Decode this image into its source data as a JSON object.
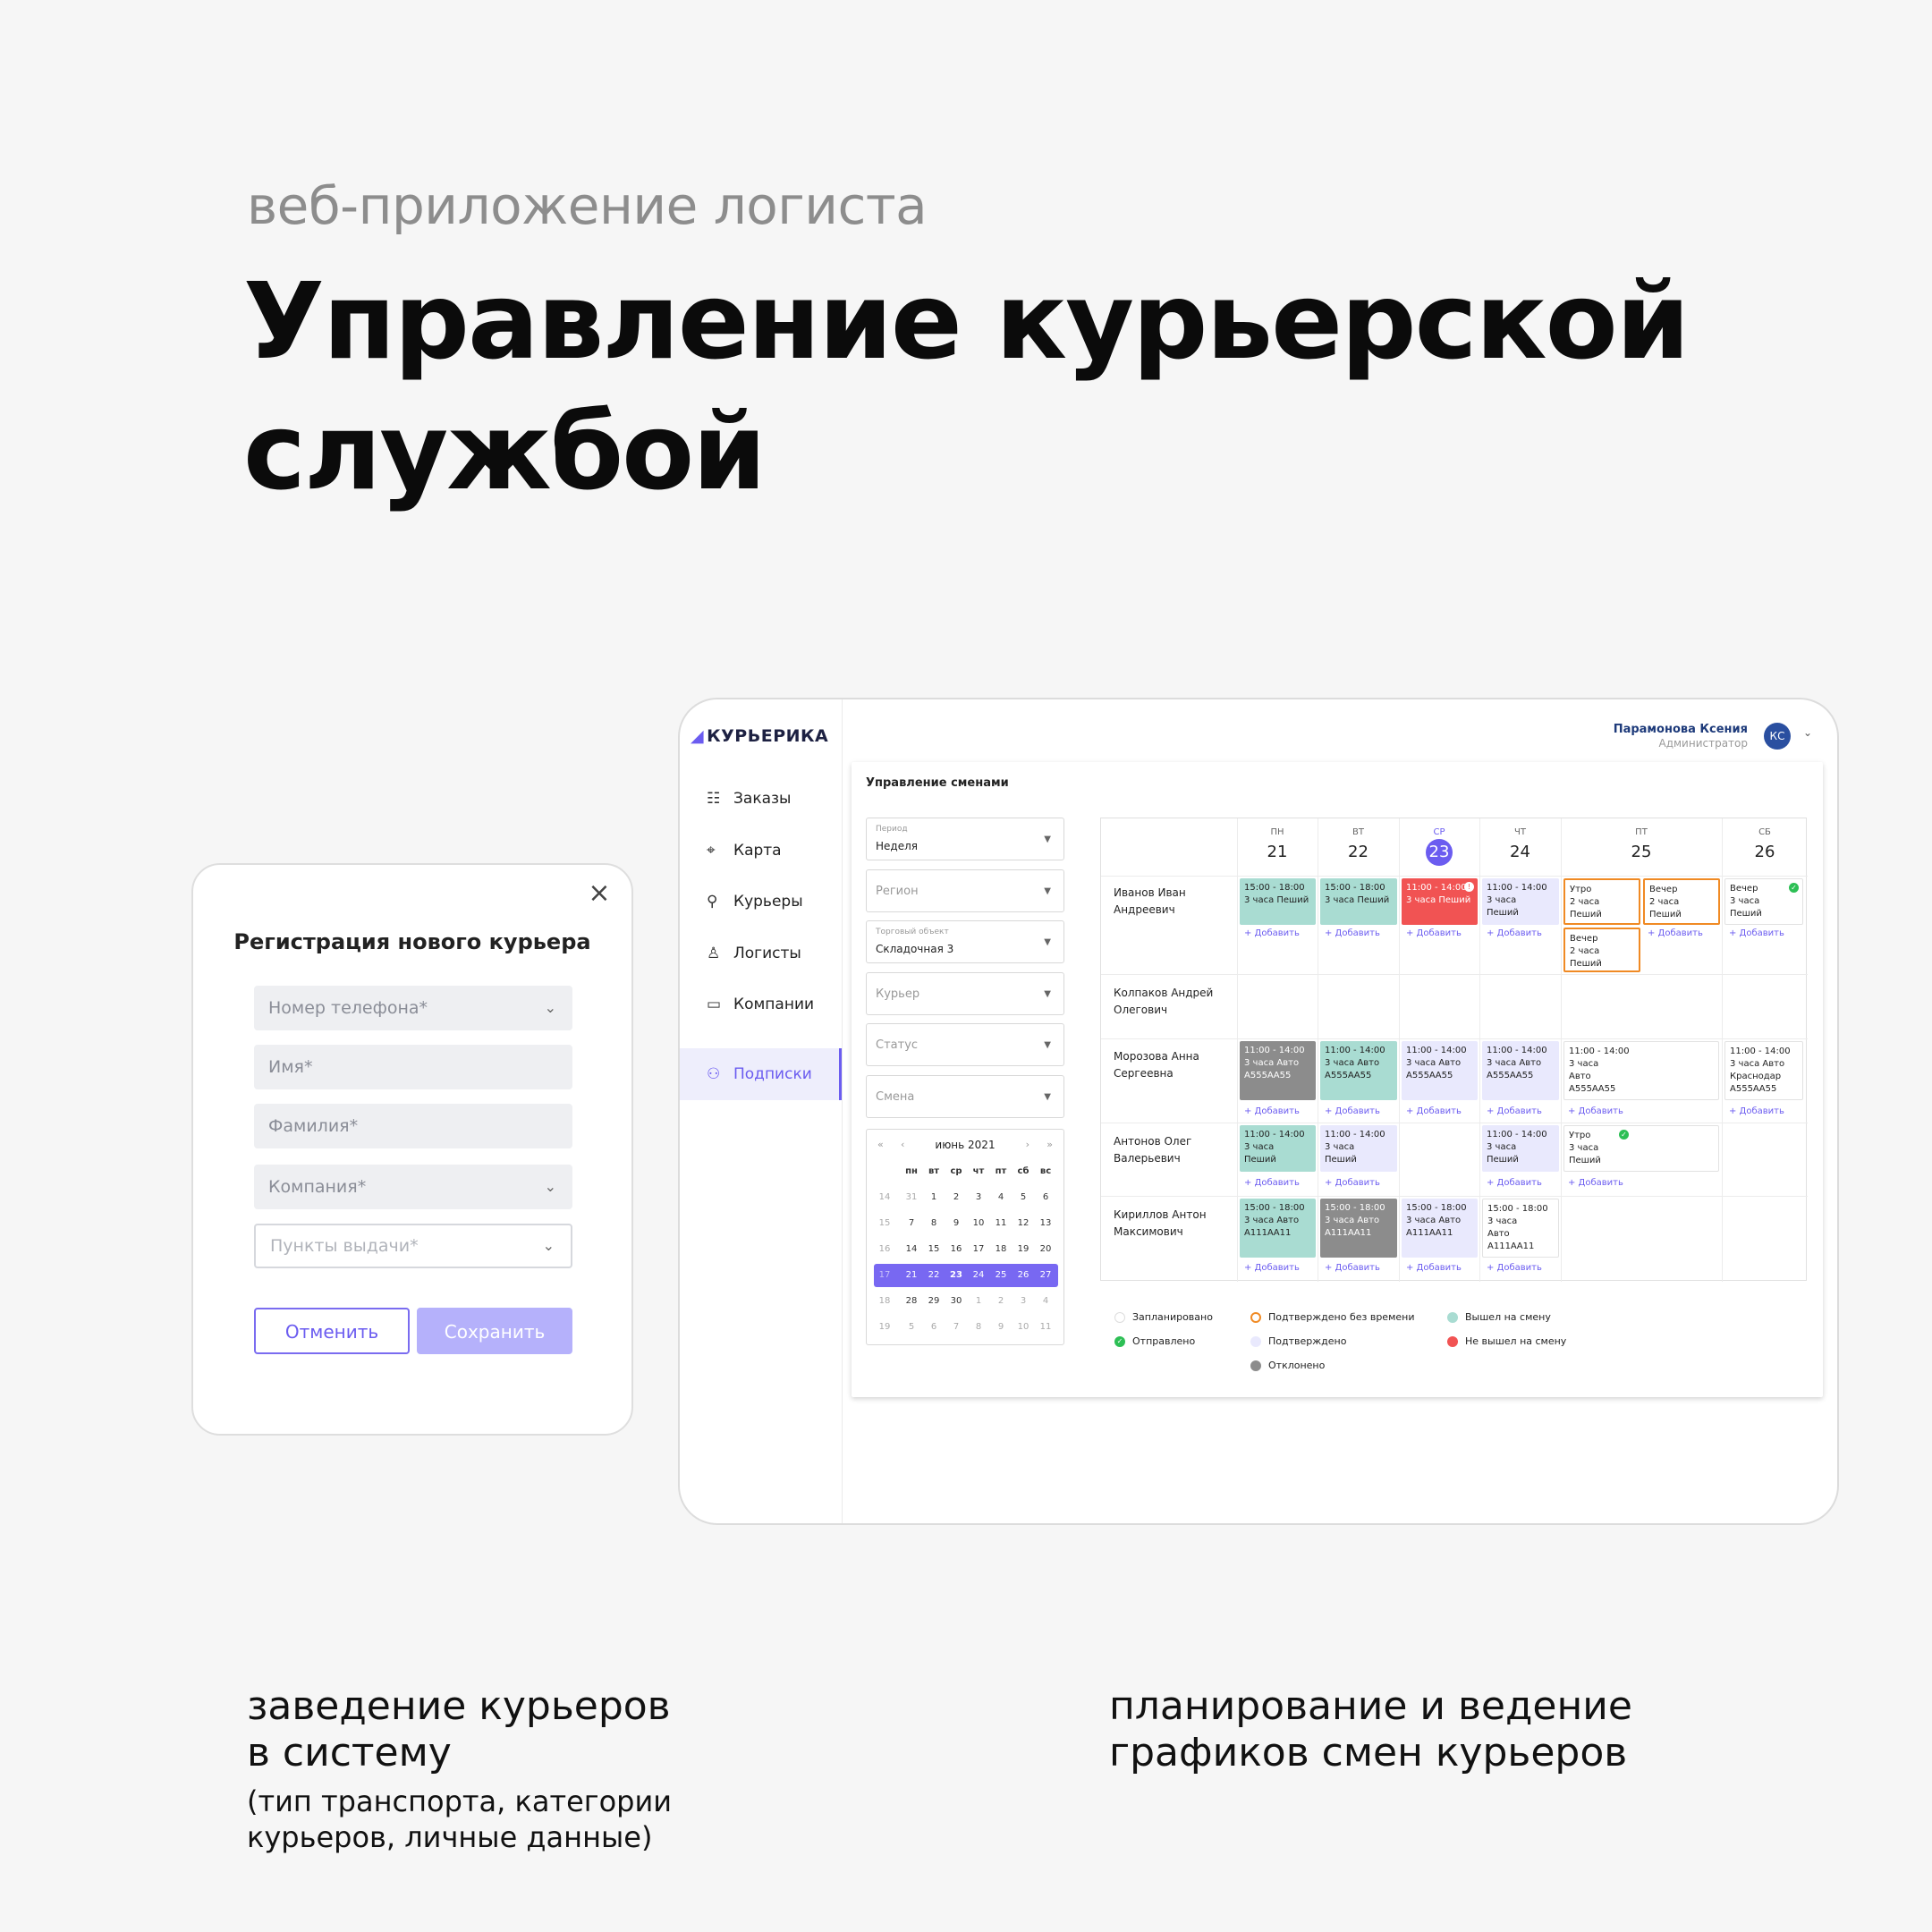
{
  "hero": {
    "kicker": "веб-приложение логиста",
    "title_line1": "Управление курьерской",
    "title_line2": "службой"
  },
  "captions": {
    "left_line1": "заведение курьеров",
    "left_line2": "в систему",
    "left_note_line1": "(тип транспорта, категории",
    "left_note_line2": "курьеров, личные данные)",
    "right_line1": "планирование и ведение",
    "right_line2": "графиков смен курьеров"
  },
  "modal": {
    "title": "Регистрация нового курьера",
    "close_icon": "close-icon",
    "fields": {
      "phone": "Номер телефона*",
      "name": "Имя*",
      "surname": "Фамилия*",
      "company": "Компания*",
      "pickup": "Пункты выдачи*"
    },
    "cancel_label": "Отменить",
    "save_label": "Сохранить"
  },
  "app": {
    "logo_text": "КУРЬЕРИКА",
    "nav": [
      {
        "label": "Заказы",
        "icon": "list-icon"
      },
      {
        "label": "Карта",
        "icon": "map-pin-icon"
      },
      {
        "label": "Курьеры",
        "icon": "walker-icon"
      },
      {
        "label": "Логисты",
        "icon": "user-icon"
      },
      {
        "label": "Компании",
        "icon": "briefcase-icon"
      },
      {
        "label": "Подписки",
        "icon": "users-icon"
      }
    ],
    "user": {
      "name": "Парамонова Ксения",
      "role": "Администратор",
      "initials": "КС"
    },
    "page_title": "Управление сменами",
    "filters": {
      "period_label": "Период",
      "period_value": "Неделя",
      "region": "Регион",
      "store_label": "Торговый объект",
      "store_value": "Складочная 3",
      "courier": "Курьер",
      "status": "Статус",
      "shift": "Смена"
    },
    "calendar": {
      "month": "июнь 2021",
      "weekdays": [
        "пн",
        "вт",
        "ср",
        "чт",
        "пт",
        "сб",
        "вс"
      ],
      "weeks": [
        {
          "wk": "14",
          "days": [
            "31",
            "1",
            "2",
            "3",
            "4",
            "5",
            "6"
          ]
        },
        {
          "wk": "15",
          "days": [
            "7",
            "8",
            "9",
            "10",
            "11",
            "12",
            "13"
          ]
        },
        {
          "wk": "16",
          "days": [
            "14",
            "15",
            "16",
            "17",
            "18",
            "19",
            "20"
          ]
        },
        {
          "wk": "17",
          "days": [
            "21",
            "22",
            "23",
            "24",
            "25",
            "26",
            "27"
          ]
        },
        {
          "wk": "18",
          "days": [
            "28",
            "29",
            "30",
            "1",
            "2",
            "3",
            "4"
          ]
        },
        {
          "wk": "19",
          "days": [
            "5",
            "6",
            "7",
            "8",
            "9",
            "10",
            "11"
          ]
        }
      ]
    },
    "days": [
      {
        "wd": "ПН",
        "num": "21"
      },
      {
        "wd": "ВТ",
        "num": "22"
      },
      {
        "wd": "СР",
        "num": "23"
      },
      {
        "wd": "ЧТ",
        "num": "24"
      },
      {
        "wd": "ПТ",
        "num": "25"
      },
      {
        "wd": "СБ",
        "num": "26"
      }
    ],
    "couriers": [
      {
        "line1": "Иванов Иван",
        "line2": "Андреевич"
      },
      {
        "line1": "Колпаков Андрей",
        "line2": "Олегович"
      },
      {
        "line1": "Морозова Анна",
        "line2": "Сергеевна"
      },
      {
        "line1": "Антонов Олег",
        "line2": "Валерьевич"
      },
      {
        "line1": "Кириллов Антон",
        "line2": "Максимович"
      }
    ],
    "shifts": {
      "r0": [
        {
          "l1": "15:00 - 18:00",
          "l2": "3 часа Пеший",
          "l3": ""
        },
        {
          "l1": "15:00 - 18:00",
          "l2": "3 часа Пеший",
          "l3": ""
        },
        {
          "l1": "11:00 - 14:00",
          "l2": "3 часа Пеший",
          "l3": ""
        },
        {
          "l1": "11:00 - 14:00",
          "l2": "3 часа",
          "l3": "Пеший"
        },
        {
          "l1": "Утро",
          "l2": "2 часа Пеший",
          "l3": ""
        },
        {
          "l1": "Вечер",
          "l2": "2 часа",
          "l3": "Пеший"
        },
        {
          "l1": "Вечер",
          "l2": "2 часа Пеший",
          "l3": ""
        },
        {
          "l1": "Вечер",
          "l2": "3 часа",
          "l3": "Пеший"
        }
      ],
      "r2": [
        {
          "l1": "11:00 - 14:00",
          "l2": "3 часа Авто",
          "l3": "А555АА55"
        },
        {
          "l1": "11:00 - 14:00",
          "l2": "3 часа Авто",
          "l3": "А555АА55"
        },
        {
          "l1": "11:00 - 14:00",
          "l2": "3 часа Авто",
          "l3": "А555АА55"
        },
        {
          "l1": "11:00 - 14:00",
          "l2": "3 часа Авто",
          "l3": "А555АА55"
        },
        {
          "l1": "11:00 - 14:00",
          "l2": "3 часа",
          "l3": "Авто",
          "l4": "А555АА55"
        },
        {
          "l1": "11:00 - 14:00",
          "l2": "3 часа Авто",
          "l3": "Краснодар",
          "l4": "А555АА55"
        }
      ],
      "r3": [
        {
          "l1": "11:00 - 14:00",
          "l2": "3 часа",
          "l3": "Пеший"
        },
        {
          "l1": "11:00 - 14:00",
          "l2": "3 часа",
          "l3": "Пеший"
        },
        {
          "l1": "11:00 - 14:00",
          "l2": "3 часа",
          "l3": "Пеший"
        },
        {
          "l1": "Утро",
          "l2": "3 часа",
          "l3": "Пеший"
        }
      ],
      "r4": [
        {
          "l1": "15:00 - 18:00",
          "l2": "3 часа Авто",
          "l3": "А111АА11"
        },
        {
          "l1": "15:00 - 18:00",
          "l2": "3 часа Авто",
          "l3": "А111АА11"
        },
        {
          "l1": "15:00 - 18:00",
          "l2": "3 часа Авто",
          "l3": "А111АА11"
        },
        {
          "l1": "15:00 - 18:00",
          "l2": "3 часа",
          "l3": "Авто",
          "l4": "А111АА11"
        }
      ]
    },
    "add_label": "+ Добавить",
    "legend": {
      "planned": "Запланировано",
      "sent": "Отправлено",
      "confirmed_no_time": "Подтверждено без времени",
      "confirmed": "Подтверждено",
      "rejected": "Отклонено",
      "on_shift": "Вышел на смену",
      "not_on_shift": "Не вышел на смену"
    },
    "colors": {
      "accent": "#6b5cf0",
      "on_shift": "#a9dcd2",
      "not_on_shift": "#f15353",
      "confirmed": "#e9e9fd",
      "rejected": "#8c8c8c",
      "confirmed_no_time": "#f08a24",
      "sent": "#2dbf55"
    }
  }
}
